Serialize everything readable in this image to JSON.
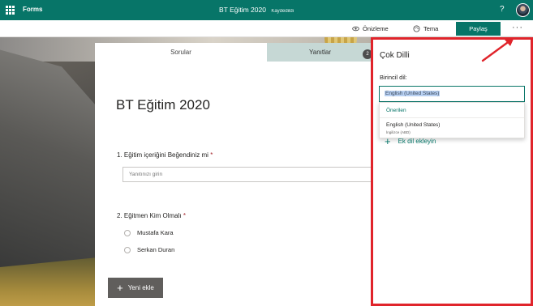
{
  "header": {
    "app_name": "Forms",
    "form_title": "BT Eğitim 2020",
    "save_status": "Kaydedildi",
    "help_icon": "question-mark-icon",
    "avatar_icon": "user-avatar-icon",
    "brand_color": "#077568"
  },
  "commandbar": {
    "preview_label": "Önizleme",
    "preview_icon": "eye-icon",
    "theme_label": "Tema",
    "theme_icon": "palette-icon",
    "share_label": "Paylaş",
    "more_label": "···"
  },
  "form": {
    "tabs": [
      {
        "label": "Sorular"
      },
      {
        "label": "Yanıtlar"
      }
    ],
    "responses_badge": "2",
    "title": "BT Eğitim 2020",
    "questions": [
      {
        "number": "1.",
        "text": "Eğitim içeriğini Beğendiniz mi",
        "required_mark": "*",
        "placeholder": "Yanıtınızı girin"
      },
      {
        "number": "2.",
        "text": "Eğitmen Kim Olmalı",
        "required_mark": "*",
        "options": [
          "Mustafa Kara",
          "Serkan Duran"
        ]
      }
    ],
    "new_button_label": "Yeni ekle"
  },
  "panel": {
    "title": "Çok Dilli",
    "primary_label": "Birincil dil:",
    "primary_value": "English (United States)",
    "dropdown": {
      "header": "Önerilen",
      "options": [
        {
          "label": "English (United States)",
          "sublabel": "İngilizce (ABD)"
        }
      ]
    },
    "add_language_label": "Ek dil ekleyin"
  },
  "annotation": {
    "highlight_color": "#e0242b"
  }
}
